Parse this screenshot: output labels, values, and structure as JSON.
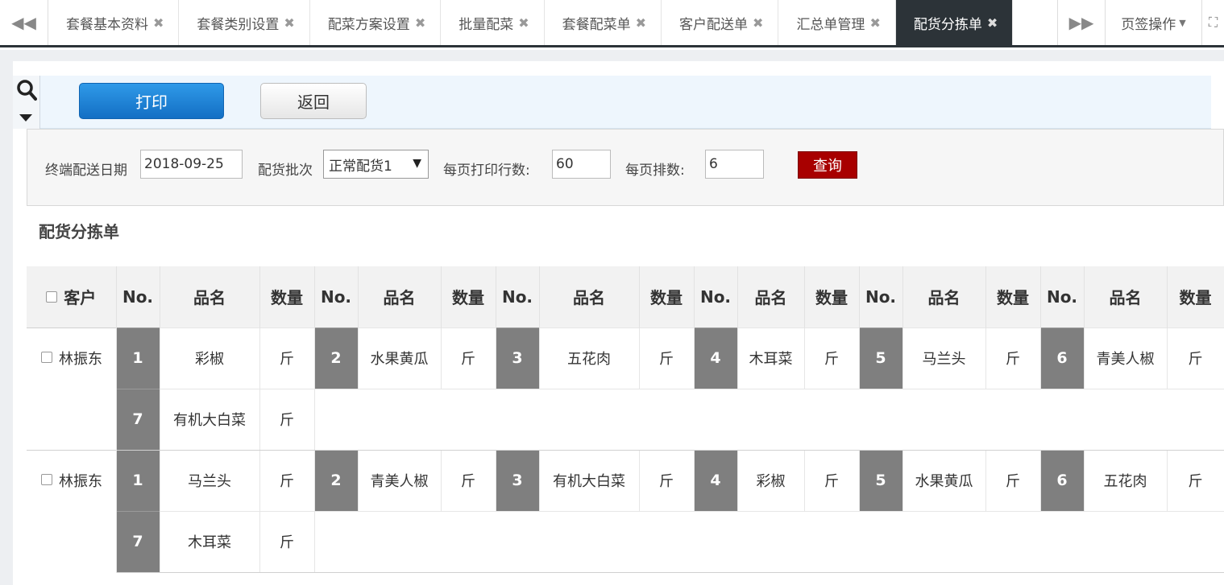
{
  "tabs": [
    {
      "label": "套餐基本资料",
      "active": false
    },
    {
      "label": "套餐类别设置",
      "active": false
    },
    {
      "label": "配菜方案设置",
      "active": false
    },
    {
      "label": "批量配菜",
      "active": false
    },
    {
      "label": "套餐配菜单",
      "active": false
    },
    {
      "label": "客户配送单",
      "active": false
    },
    {
      "label": "汇总单管理",
      "active": false
    },
    {
      "label": "配货分拣单",
      "active": true
    }
  ],
  "tab_ops_label": "页签操作",
  "toolbar": {
    "print_label": "打印",
    "back_label": "返回"
  },
  "filter": {
    "date_label": "终端配送日期",
    "date_value": "2018-09-25",
    "batch_label": "配货批次",
    "batch_value": "正常配货1",
    "rows_label": "每页打印行数:",
    "rows_value": "60",
    "cols_label": "每页排数:",
    "cols_value": "6",
    "query_label": "查询"
  },
  "report_title": "配货分拣单",
  "table": {
    "customer_header": "客户",
    "no_header": "No.",
    "name_header": "品名",
    "qty_header": "数量",
    "groups": [
      {
        "customer": "林振东",
        "rows": [
          [
            {
              "no": "1",
              "name": "彩椒",
              "qty": "斤"
            },
            {
              "no": "2",
              "name": "水果黄瓜",
              "qty": "斤"
            },
            {
              "no": "3",
              "name": "五花肉",
              "qty": "斤"
            },
            {
              "no": "4",
              "name": "木耳菜",
              "qty": "斤"
            },
            {
              "no": "5",
              "name": "马兰头",
              "qty": "斤"
            },
            {
              "no": "6",
              "name": "青美人椒",
              "qty": "斤"
            }
          ],
          [
            {
              "no": "7",
              "name": "有机大白菜",
              "qty": "斤"
            }
          ]
        ]
      },
      {
        "customer": "林振东",
        "rows": [
          [
            {
              "no": "1",
              "name": "马兰头",
              "qty": "斤"
            },
            {
              "no": "2",
              "name": "青美人椒",
              "qty": "斤"
            },
            {
              "no": "3",
              "name": "有机大白菜",
              "qty": "斤"
            },
            {
              "no": "4",
              "name": "彩椒",
              "qty": "斤"
            },
            {
              "no": "5",
              "name": "水果黄瓜",
              "qty": "斤"
            },
            {
              "no": "6",
              "name": "五花肉",
              "qty": "斤"
            }
          ],
          [
            {
              "no": "7",
              "name": "木耳菜",
              "qty": "斤"
            }
          ]
        ]
      }
    ]
  }
}
